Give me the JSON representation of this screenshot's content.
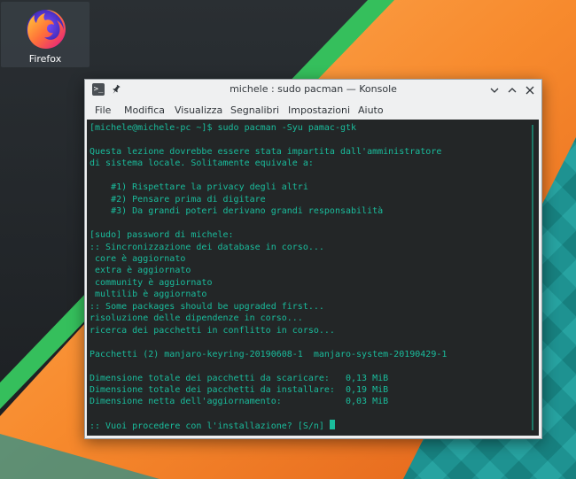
{
  "desktop": {
    "icons": [
      {
        "label": "Firefox",
        "icon": "firefox-icon"
      }
    ]
  },
  "window": {
    "title": "michele : sudo pacman — Konsole",
    "app_icon": "konsole-icon",
    "app_icon_glyph": ">_",
    "buttons": [
      "minimize-icon",
      "maximize-icon",
      "close-icon"
    ],
    "menu": [
      "File",
      "Modifica",
      "Visualizza",
      "Segnalibri",
      "Impostazioni",
      "Aiuto"
    ]
  },
  "terminal": {
    "lines": [
      "[michele@michele-pc ~]$ sudo pacman -Syu pamac-gtk",
      "",
      "Questa lezione dovrebbe essere stata impartita dall'amministratore",
      "di sistema locale. Solitamente equivale a:",
      "",
      "    #1) Rispettare la privacy degli altri",
      "    #2) Pensare prima di digitare",
      "    #3) Da grandi poteri derivano grandi responsabilità",
      "",
      "[sudo] password di michele:",
      ":: Sincronizzazione dei database in corso...",
      " core è aggiornato",
      " extra è aggiornato",
      " community è aggiornato",
      " multilib è aggiornato",
      ":: Some packages should be upgraded first...",
      "risoluzione delle dipendenze in corso...",
      "ricerca dei pacchetti in conflitto in corso...",
      "",
      "Pacchetti (2) manjaro-keyring-20190608-1  manjaro-system-20190429-1",
      "",
      "Dimensione totale dei pacchetti da scaricare:   0,13 MiB",
      "Dimensione totale dei pacchetti da installare:  0,19 MiB",
      "Dimensione netta dell'aggiornamento:            0,03 MiB",
      ""
    ],
    "prompt": ":: Vuoi procedere con l'installazione? [S/n] "
  },
  "colors": {
    "terminal_bg": "#232627",
    "terminal_fg": "#1abc9c",
    "accent_green": "#35bf5c",
    "accent_orange": "#f57d1f",
    "accent_teal": "#1b8c8c"
  }
}
